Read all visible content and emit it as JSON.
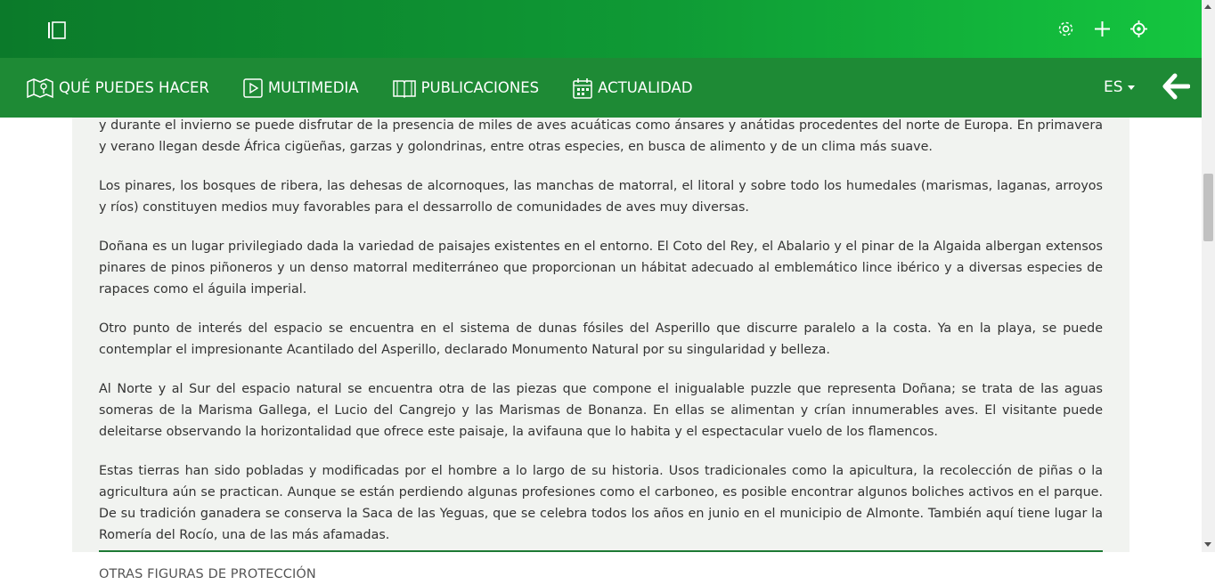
{
  "topbar": {
    "icons": [
      "sidebar-toggle-icon",
      "gear-icon",
      "plus-icon",
      "location-target-icon"
    ]
  },
  "nav": {
    "items": [
      {
        "label": "QUÉ PUEDES HACER",
        "icon": "map-pin-icon"
      },
      {
        "label": "MULTIMEDIA",
        "icon": "play-icon"
      },
      {
        "label": "PUBLICACIONES",
        "icon": "book-icon"
      },
      {
        "label": "ACTUALIDAD",
        "icon": "calendar-icon"
      }
    ],
    "language": "ES"
  },
  "content": {
    "paragraphs": [
      "y durante el invierno se puede disfrutar de la presencia de miles de aves acuáticas como ánsares y anátidas procedentes del norte de Europa. En primavera y verano llegan desde África cigüeñas, garzas y golondrinas, entre otras especies, en busca de alimento y de un clima más suave.",
      "Los pinares, los bosques de ribera, las dehesas de alcornoques, las manchas de matorral, el litoral y sobre todo los humedales (marismas, laganas, arroyos y ríos) constituyen medios muy favorables para el dessarrollo de comunidades de aves muy diversas.",
      "Doñana es un lugar privilegiado dada la variedad de paisajes existentes en el entorno. El Coto del Rey, el Abalario y el pinar de la Algaida albergan extensos pinares de pinos piñoneros y un denso matorral mediterráneo que proporcionan un hábitat adecuado al emblemático lince ibérico y a diversas especies de rapaces como el águila imperial.",
      "Otro punto de interés del espacio se encuentra en el sistema de dunas fósiles del Asperillo que discurre paralelo a la costa. Ya en la playa, se puede contemplar el impresionante Acantilado del Asperillo, declarado Monumento Natural por su singularidad y belleza.",
      "Al Norte y al Sur del espacio natural se encuentra otra de las piezas que compone el inigualable puzzle que representa Doñana; se trata de las aguas someras de la Marisma Gallega, el Lucio del Cangrejo y las Marismas de Bonanza. En ellas se alimentan y crían innumerables aves. El visitante puede deleitarse observando la horizontalidad que ofrece este paisaje, la avifauna que lo habita y el espectacular vuelo de los flamencos.",
      "Estas tierras han sido pobladas y modificadas por el hombre a lo largo de su historia. Usos tradicionales como la apicultura, la recolección de piñas o la agricultura aún se practican. Aunque se están perdiendo algunas profesiones como el carboneo, es posible encontrar algunos boliches activos en el parque. De su tradición ganadera se conserva la Saca de las Yeguas, que se celebra todos los años en junio en el municipio de Almonte. También aquí tiene lugar la Romería del Rocío, una de las más afamadas."
    ],
    "section_heading": "OTRAS FIGURAS DE PROTECCIÓN"
  },
  "colors": {
    "topbar_start": "#0b7a2a",
    "topbar_end": "#14c63f",
    "navbar": "#1e8a35",
    "content_bg": "#f1f3f0",
    "text": "#333333"
  }
}
